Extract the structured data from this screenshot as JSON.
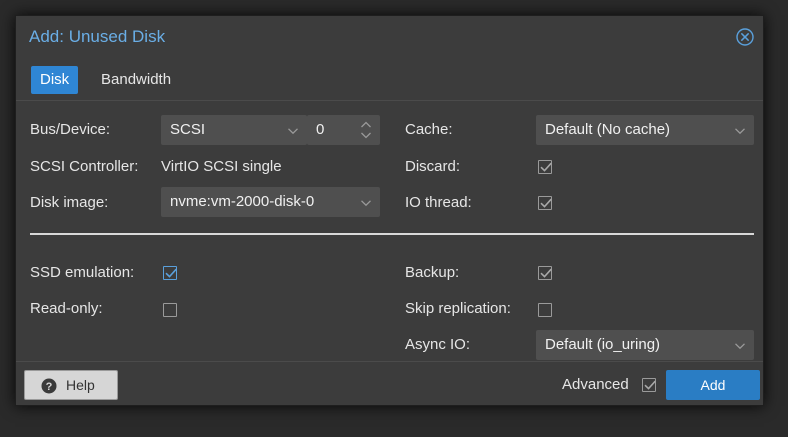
{
  "dialog": {
    "title": "Add: Unused Disk",
    "close_icon": "close-circle-icon"
  },
  "tabs": [
    {
      "label": "Disk",
      "active": true
    },
    {
      "label": "Bandwidth",
      "active": false
    }
  ],
  "left": {
    "bus_device": {
      "label": "Bus/Device:",
      "bus": "SCSI",
      "device": "0"
    },
    "scsi_controller": {
      "label": "SCSI Controller:",
      "value": "VirtIO SCSI single"
    },
    "disk_image": {
      "label": "Disk image:",
      "value": "nvme:vm-2000-disk-0"
    },
    "ssd_emulation": {
      "label": "SSD emulation:",
      "checked": true
    },
    "read_only": {
      "label": "Read-only:",
      "checked": false
    }
  },
  "right": {
    "cache": {
      "label": "Cache:",
      "value": "Default (No cache)"
    },
    "discard": {
      "label": "Discard:",
      "checked": true
    },
    "io_thread": {
      "label": "IO thread:",
      "checked": true
    },
    "backup": {
      "label": "Backup:",
      "checked": true
    },
    "skip_replication": {
      "label": "Skip replication:",
      "checked": false
    },
    "async_io": {
      "label": "Async IO:",
      "value": "Default (io_uring)"
    }
  },
  "footer": {
    "help_label": "Help",
    "help_icon": "question-circle-icon",
    "advanced_label": "Advanced",
    "advanced_checked": true,
    "add_label": "Add"
  },
  "colors": {
    "accent": "#2f86d4",
    "title": "#6aaee6",
    "dialog_bg": "#3c3c3c",
    "field_bg": "#4f4f4f"
  }
}
